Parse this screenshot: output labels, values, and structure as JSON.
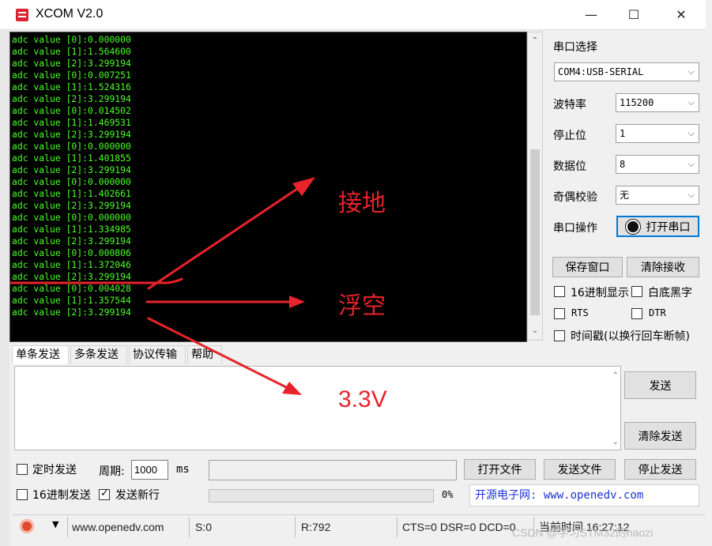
{
  "window": {
    "title": "XCOM V2.0",
    "controls": [
      "—",
      "☐",
      "✕"
    ]
  },
  "console": {
    "lines": [
      "adc value [0]:0.000000",
      "adc value [1]:1.564600",
      "adc value [2]:3.299194",
      "adc value [0]:0.007251",
      "adc value [1]:1.524316",
      "adc value [2]:3.299194",
      "adc value [0]:0.014502",
      "adc value [1]:1.469531",
      "adc value [2]:3.299194",
      "adc value [0]:0.000000",
      "adc value [1]:1.401855",
      "adc value [2]:3.299194",
      "adc value [0]:0.000000",
      "adc value [1]:1.402661",
      "adc value [2]:3.299194",
      "adc value [0]:0.000000",
      "adc value [1]:1.334985",
      "adc value [2]:3.299194",
      "adc value [0]:0.000806",
      "adc value [1]:1.372046",
      "adc value [2]:3.299194",
      "adc value [0]:0.004028",
      "adc value [1]:1.357544",
      "adc value [2]:3.299194"
    ],
    "text_color": "#4cff28"
  },
  "settings": {
    "port_label": "串口选择",
    "port_value": "COM4:USB-SERIAL",
    "baud_label": "波特率",
    "baud_value": "115200",
    "stop_label": "停止位",
    "stop_value": "1",
    "data_label": "数据位",
    "data_value": "8",
    "parity_label": "奇偶校验",
    "parity_value": "无",
    "op_label": "串口操作",
    "open_port_button": "打开串口",
    "save_window_button": "保存窗口",
    "clear_receive_button": "清除接收",
    "hex_display": "16进制显示",
    "white_bg": "白底黑字",
    "rts": "RTS",
    "dtr": "DTR",
    "timestamp": "时间戳(以换行回车断帧)"
  },
  "tabs": [
    "单条发送",
    "多条发送",
    "协议传输",
    "帮助"
  ],
  "send": {
    "send_button": "发送",
    "clear_send_button": "清除发送",
    "timed_send": "定时发送",
    "period_label": "周期:",
    "period_value": "1000",
    "period_unit": "ms",
    "open_file_button": "打开文件",
    "send_file_button": "发送文件",
    "stop_send_button": "停止发送",
    "hex_send": "16进制发送",
    "send_newline": "发送新行",
    "progress_text": "0%",
    "progress": 0,
    "site_text": "开源电子网: www.openedv.com"
  },
  "status": {
    "url": "www.openedv.com",
    "sent": "S:0",
    "received": "R:792",
    "signals": "CTS=0 DSR=0 DCD=0",
    "time": "当前时间 16:27:12"
  },
  "annotations": {
    "ground": "接地",
    "floating": "浮空",
    "v33": "3.3V",
    "color": "#e8232b"
  },
  "watermark": "CSDN @学习STM32的haozi"
}
